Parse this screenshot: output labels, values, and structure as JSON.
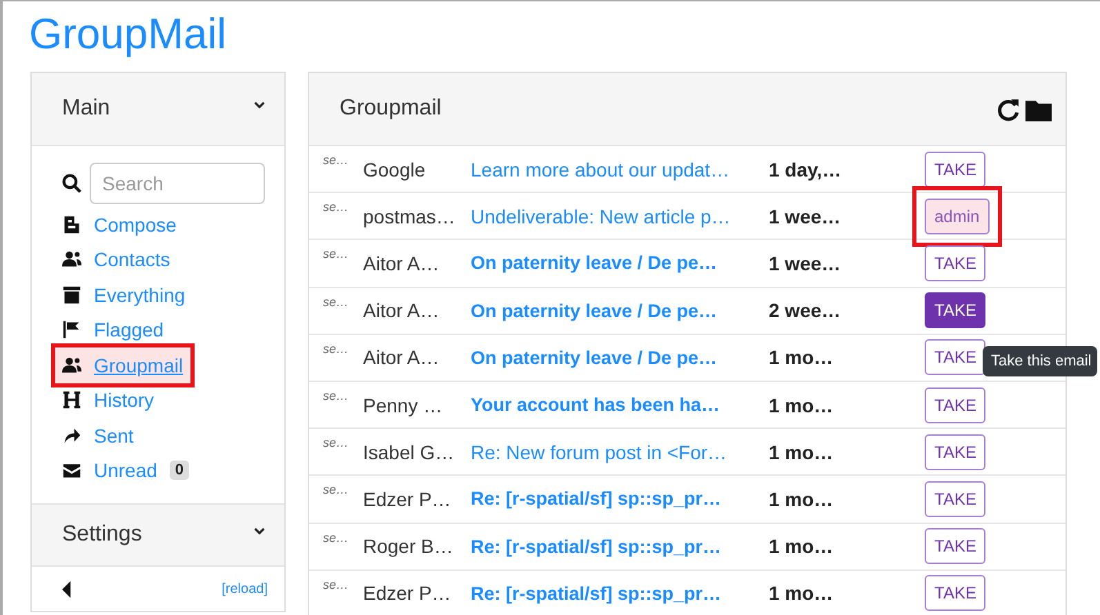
{
  "app_title": "GroupMail",
  "sidebar": {
    "main_section": {
      "title": "Main",
      "expanded": true
    },
    "search": {
      "placeholder": "Search"
    },
    "items": [
      {
        "label": "Compose",
        "kind": "compose",
        "highlighted": false
      },
      {
        "label": "Contacts",
        "kind": "people",
        "highlighted": false
      },
      {
        "label": "Everything",
        "kind": "archive",
        "highlighted": false
      },
      {
        "label": "Flagged",
        "kind": "flag",
        "highlighted": false
      },
      {
        "label": "Groupmail",
        "kind": "people",
        "highlighted": true
      },
      {
        "label": "History",
        "kind": "history",
        "highlighted": false
      },
      {
        "label": "Sent",
        "kind": "sent",
        "highlighted": false
      },
      {
        "label": "Unread",
        "kind": "mail",
        "highlighted": false,
        "badge": "0"
      }
    ],
    "settings_section": {
      "title": "Settings",
      "expanded": false
    },
    "reload": "[reload]"
  },
  "mailbox": {
    "title": "Groupmail",
    "rows": [
      {
        "column_1": "se…",
        "sender": "Google",
        "subject": "Learn more about our updat…",
        "date": "1 day,…",
        "unread": false,
        "button": {
          "kind": "take",
          "label": "TAKE",
          "active": false,
          "highlighted": false
        }
      },
      {
        "column_1": "se…",
        "sender": "postmas…",
        "subject": "Undeliverable: New article p…",
        "date": "1 wee…",
        "unread": false,
        "button": {
          "kind": "owner",
          "label": "admin",
          "active": false,
          "highlighted": true
        }
      },
      {
        "column_1": "se…",
        "sender": "Aitor A…",
        "subject": "On paternity leave / De pe…",
        "date": "1 wee…",
        "unread": true,
        "button": {
          "kind": "take",
          "label": "TAKE",
          "active": false,
          "highlighted": false
        }
      },
      {
        "column_1": "se…",
        "sender": "Aitor A…",
        "subject": "On paternity leave / De pe…",
        "date": "2 wee…",
        "unread": true,
        "button": {
          "kind": "take",
          "label": "TAKE",
          "active": true,
          "highlighted": false
        }
      },
      {
        "column_1": "se…",
        "sender": "Aitor A…",
        "subject": "On paternity leave / De pe…",
        "date": "1 mo…",
        "unread": true,
        "button": {
          "kind": "take",
          "label": "TAKE",
          "active": false,
          "highlighted": false
        }
      },
      {
        "column_1": "se…",
        "sender": "Penny …",
        "subject": "Your account has been ha…",
        "date": "1 mo…",
        "unread": true,
        "button": {
          "kind": "take",
          "label": "TAKE",
          "active": false,
          "highlighted": false
        }
      },
      {
        "column_1": "se…",
        "sender": "Isabel G…",
        "subject": "Re: New forum post in <For…",
        "date": "1 mo…",
        "unread": false,
        "button": {
          "kind": "take",
          "label": "TAKE",
          "active": false,
          "highlighted": false
        }
      },
      {
        "column_1": "se…",
        "sender": "Edzer P…",
        "subject": "Re: [r-spatial/sf] sp::sp_pr…",
        "date": "1 mo…",
        "unread": true,
        "button": {
          "kind": "take",
          "label": "TAKE",
          "active": false,
          "highlighted": false
        }
      },
      {
        "column_1": "se…",
        "sender": "Roger B…",
        "subject": "Re: [r-spatial/sf] sp::sp_pr…",
        "date": "1 mo…",
        "unread": true,
        "button": {
          "kind": "take",
          "label": "TAKE",
          "active": false,
          "highlighted": false
        }
      },
      {
        "column_1": "se…",
        "sender": "Edzer P…",
        "subject": "Re: [r-spatial/sf] sp::sp_pr…",
        "date": "1 mo…",
        "unread": true,
        "button": {
          "kind": "take",
          "label": "TAKE",
          "active": false,
          "highlighted": false
        }
      }
    ],
    "tooltip": "Take this email"
  }
}
